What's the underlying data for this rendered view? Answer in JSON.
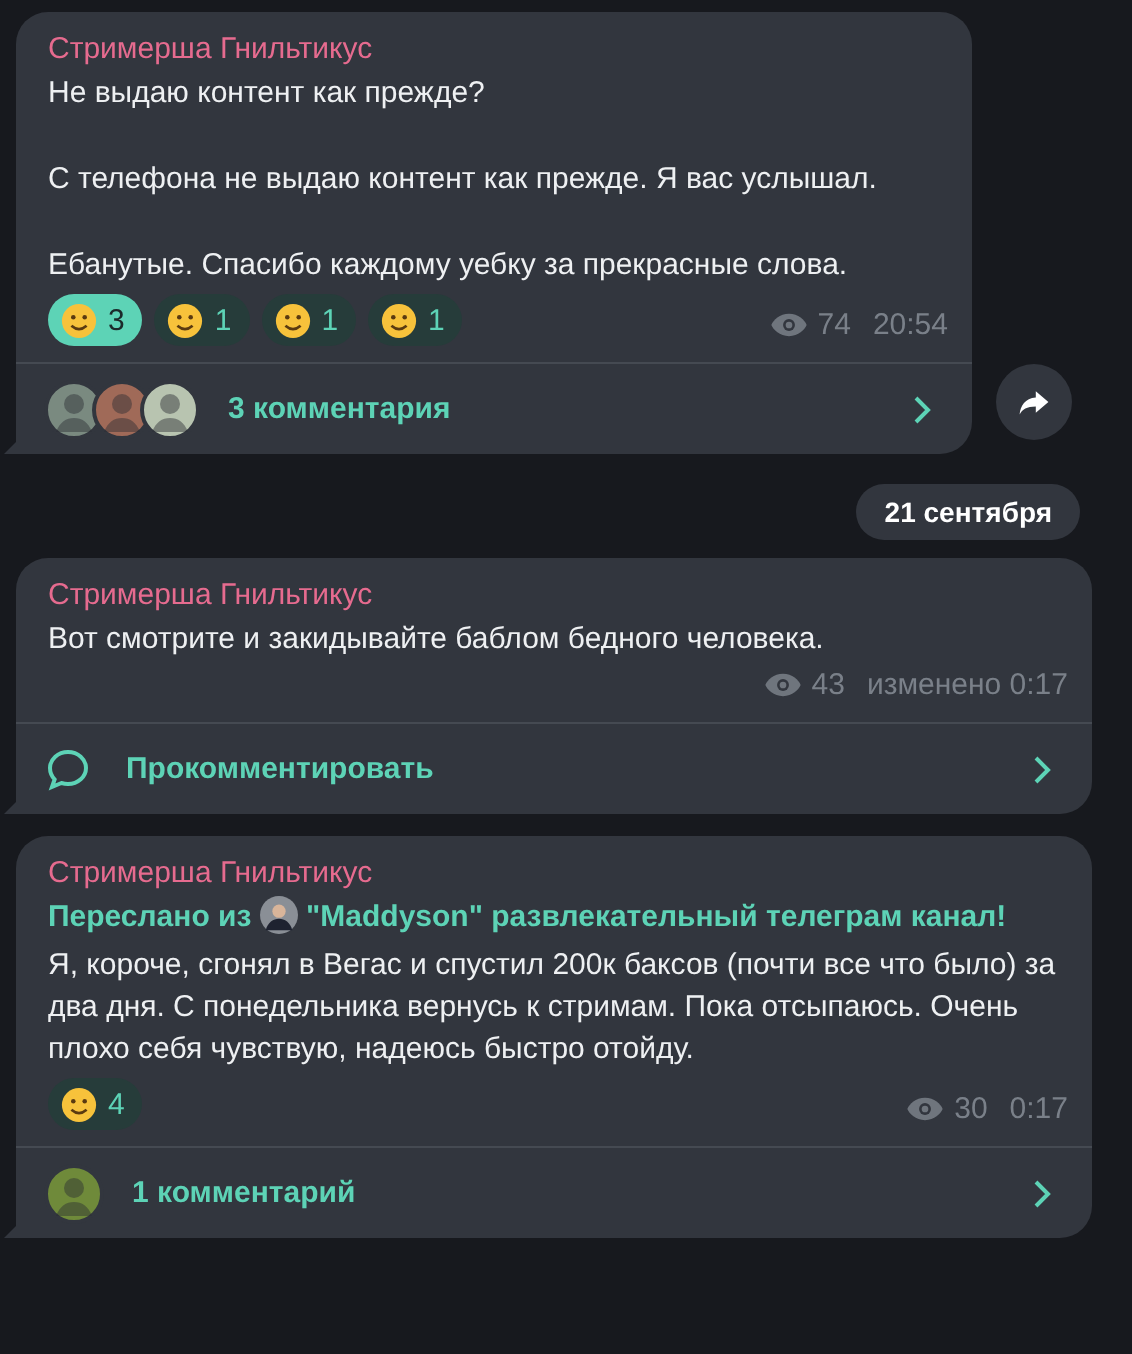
{
  "messages": [
    {
      "author": "Стримерша Гнильтикус",
      "paragraphs": [
        "Не выдаю контент как прежде?",
        "С телефона не выдаю контент как прежде. Я вас услышал.",
        "Ебанутые. Спасибо каждому уебку за прекрасные слова."
      ],
      "reactions": [
        {
          "count": "3",
          "selected": true
        },
        {
          "count": "1",
          "selected": false
        },
        {
          "count": "1",
          "selected": false
        },
        {
          "count": "1",
          "selected": false
        }
      ],
      "views": "74",
      "time": "20:54",
      "comments": {
        "kind": "avatars",
        "avatars": [
          {
            "color": "#7a8a80"
          },
          {
            "color": "#a06a58"
          },
          {
            "color": "#b8c4b0"
          }
        ],
        "label": "3 комментария"
      },
      "share": true
    },
    {
      "date": "21 сентября"
    },
    {
      "author": "Стримерша Гнильтикус",
      "paragraphs": [
        "Вот смотрите и закидывайте баблом бедного человека."
      ],
      "views": "43",
      "time": "изменено 0:17",
      "comments": {
        "kind": "prompt",
        "label": "Прокомментировать"
      },
      "share": false
    },
    {
      "author": "Стримерша Гнильтикус",
      "forward": {
        "prefix": "Переслано из",
        "channel": "\"Maddyson\" развлекательный телеграм канал!"
      },
      "paragraphs": [
        "Я, короче, сгонял в Вегас и спустил 200к баксов (почти все что было) за два дня. С понедельника вернусь к стримам. Пока отсыпаюсь. Очень плохо себя чувствую, надеюсь быстро отойду."
      ],
      "reactions": [
        {
          "count": "4",
          "selected": false
        }
      ],
      "views": "30",
      "time": "0:17",
      "comments": {
        "kind": "avatars",
        "avatars": [
          {
            "color": "#6f8a3a"
          }
        ],
        "label": "1 комментарий"
      },
      "share": false
    }
  ]
}
